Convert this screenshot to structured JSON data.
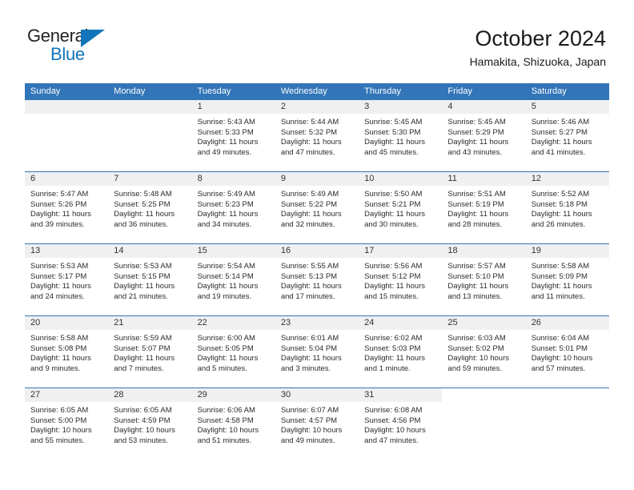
{
  "brand": {
    "name_part1": "General",
    "name_part2": "Blue",
    "accent_color": "#1275bc"
  },
  "header": {
    "title": "October 2024",
    "subtitle": "Hamakita, Shizuoka, Japan",
    "header_bg_color": "#3275b8"
  },
  "weekday_headers": [
    "Sunday",
    "Monday",
    "Tuesday",
    "Wednesday",
    "Thursday",
    "Friday",
    "Saturday"
  ],
  "weeks": [
    [
      {
        "day": "",
        "sunrise": "",
        "sunset": "",
        "daylight": "",
        "empty": true
      },
      {
        "day": "",
        "sunrise": "",
        "sunset": "",
        "daylight": "",
        "empty": true
      },
      {
        "day": "1",
        "sunrise": "Sunrise: 5:43 AM",
        "sunset": "Sunset: 5:33 PM",
        "daylight": "Daylight: 11 hours and 49 minutes."
      },
      {
        "day": "2",
        "sunrise": "Sunrise: 5:44 AM",
        "sunset": "Sunset: 5:32 PM",
        "daylight": "Daylight: 11 hours and 47 minutes."
      },
      {
        "day": "3",
        "sunrise": "Sunrise: 5:45 AM",
        "sunset": "Sunset: 5:30 PM",
        "daylight": "Daylight: 11 hours and 45 minutes."
      },
      {
        "day": "4",
        "sunrise": "Sunrise: 5:45 AM",
        "sunset": "Sunset: 5:29 PM",
        "daylight": "Daylight: 11 hours and 43 minutes."
      },
      {
        "day": "5",
        "sunrise": "Sunrise: 5:46 AM",
        "sunset": "Sunset: 5:27 PM",
        "daylight": "Daylight: 11 hours and 41 minutes."
      }
    ],
    [
      {
        "day": "6",
        "sunrise": "Sunrise: 5:47 AM",
        "sunset": "Sunset: 5:26 PM",
        "daylight": "Daylight: 11 hours and 39 minutes."
      },
      {
        "day": "7",
        "sunrise": "Sunrise: 5:48 AM",
        "sunset": "Sunset: 5:25 PM",
        "daylight": "Daylight: 11 hours and 36 minutes."
      },
      {
        "day": "8",
        "sunrise": "Sunrise: 5:49 AM",
        "sunset": "Sunset: 5:23 PM",
        "daylight": "Daylight: 11 hours and 34 minutes."
      },
      {
        "day": "9",
        "sunrise": "Sunrise: 5:49 AM",
        "sunset": "Sunset: 5:22 PM",
        "daylight": "Daylight: 11 hours and 32 minutes."
      },
      {
        "day": "10",
        "sunrise": "Sunrise: 5:50 AM",
        "sunset": "Sunset: 5:21 PM",
        "daylight": "Daylight: 11 hours and 30 minutes."
      },
      {
        "day": "11",
        "sunrise": "Sunrise: 5:51 AM",
        "sunset": "Sunset: 5:19 PM",
        "daylight": "Daylight: 11 hours and 28 minutes."
      },
      {
        "day": "12",
        "sunrise": "Sunrise: 5:52 AM",
        "sunset": "Sunset: 5:18 PM",
        "daylight": "Daylight: 11 hours and 26 minutes."
      }
    ],
    [
      {
        "day": "13",
        "sunrise": "Sunrise: 5:53 AM",
        "sunset": "Sunset: 5:17 PM",
        "daylight": "Daylight: 11 hours and 24 minutes."
      },
      {
        "day": "14",
        "sunrise": "Sunrise: 5:53 AM",
        "sunset": "Sunset: 5:15 PM",
        "daylight": "Daylight: 11 hours and 21 minutes."
      },
      {
        "day": "15",
        "sunrise": "Sunrise: 5:54 AM",
        "sunset": "Sunset: 5:14 PM",
        "daylight": "Daylight: 11 hours and 19 minutes."
      },
      {
        "day": "16",
        "sunrise": "Sunrise: 5:55 AM",
        "sunset": "Sunset: 5:13 PM",
        "daylight": "Daylight: 11 hours and 17 minutes."
      },
      {
        "day": "17",
        "sunrise": "Sunrise: 5:56 AM",
        "sunset": "Sunset: 5:12 PM",
        "daylight": "Daylight: 11 hours and 15 minutes."
      },
      {
        "day": "18",
        "sunrise": "Sunrise: 5:57 AM",
        "sunset": "Sunset: 5:10 PM",
        "daylight": "Daylight: 11 hours and 13 minutes."
      },
      {
        "day": "19",
        "sunrise": "Sunrise: 5:58 AM",
        "sunset": "Sunset: 5:09 PM",
        "daylight": "Daylight: 11 hours and 11 minutes."
      }
    ],
    [
      {
        "day": "20",
        "sunrise": "Sunrise: 5:58 AM",
        "sunset": "Sunset: 5:08 PM",
        "daylight": "Daylight: 11 hours and 9 minutes."
      },
      {
        "day": "21",
        "sunrise": "Sunrise: 5:59 AM",
        "sunset": "Sunset: 5:07 PM",
        "daylight": "Daylight: 11 hours and 7 minutes."
      },
      {
        "day": "22",
        "sunrise": "Sunrise: 6:00 AM",
        "sunset": "Sunset: 5:05 PM",
        "daylight": "Daylight: 11 hours and 5 minutes."
      },
      {
        "day": "23",
        "sunrise": "Sunrise: 6:01 AM",
        "sunset": "Sunset: 5:04 PM",
        "daylight": "Daylight: 11 hours and 3 minutes."
      },
      {
        "day": "24",
        "sunrise": "Sunrise: 6:02 AM",
        "sunset": "Sunset: 5:03 PM",
        "daylight": "Daylight: 11 hours and 1 minute."
      },
      {
        "day": "25",
        "sunrise": "Sunrise: 6:03 AM",
        "sunset": "Sunset: 5:02 PM",
        "daylight": "Daylight: 10 hours and 59 minutes."
      },
      {
        "day": "26",
        "sunrise": "Sunrise: 6:04 AM",
        "sunset": "Sunset: 5:01 PM",
        "daylight": "Daylight: 10 hours and 57 minutes."
      }
    ],
    [
      {
        "day": "27",
        "sunrise": "Sunrise: 6:05 AM",
        "sunset": "Sunset: 5:00 PM",
        "daylight": "Daylight: 10 hours and 55 minutes."
      },
      {
        "day": "28",
        "sunrise": "Sunrise: 6:05 AM",
        "sunset": "Sunset: 4:59 PM",
        "daylight": "Daylight: 10 hours and 53 minutes."
      },
      {
        "day": "29",
        "sunrise": "Sunrise: 6:06 AM",
        "sunset": "Sunset: 4:58 PM",
        "daylight": "Daylight: 10 hours and 51 minutes."
      },
      {
        "day": "30",
        "sunrise": "Sunrise: 6:07 AM",
        "sunset": "Sunset: 4:57 PM",
        "daylight": "Daylight: 10 hours and 49 minutes."
      },
      {
        "day": "31",
        "sunrise": "Sunrise: 6:08 AM",
        "sunset": "Sunset: 4:56 PM",
        "daylight": "Daylight: 10 hours and 47 minutes."
      },
      {
        "day": "",
        "sunrise": "",
        "sunset": "",
        "daylight": "",
        "blank": true
      },
      {
        "day": "",
        "sunrise": "",
        "sunset": "",
        "daylight": "",
        "blank": true
      }
    ]
  ]
}
